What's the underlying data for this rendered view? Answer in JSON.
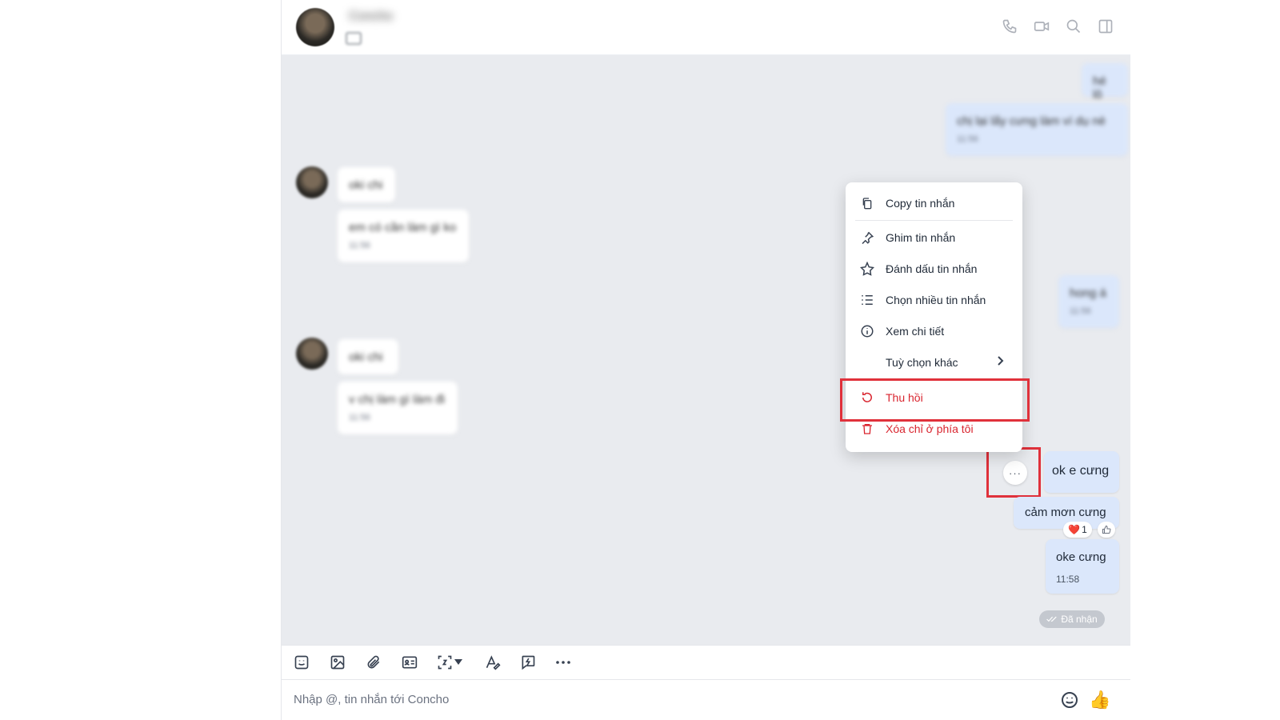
{
  "header": {
    "contact_name": "Concho"
  },
  "blurred": {
    "me_1": "hé lô",
    "me_2": "chị lại lấy cưng làm ví dụ nè",
    "peer_1": "oki chi",
    "peer_2": "em có cần làm gì ko",
    "peer_3": "oki chi",
    "peer_4": "v chị làm gì làm đi",
    "me_3": "hong á",
    "time": "11:56"
  },
  "messages": [
    {
      "text": "ok e cưng"
    },
    {
      "text": "cảm mơn cưng",
      "reaction_emoji": "❤️",
      "reaction_count": "1"
    },
    {
      "text": "oke cưng",
      "time": "11:58"
    }
  ],
  "status": {
    "received": "Đã nhận"
  },
  "context_menu": {
    "copy": "Copy tin nhắn",
    "pin": "Ghim tin nhắn",
    "mark": "Đánh dấu tin nhắn",
    "select_multiple": "Chọn nhiều tin nhắn",
    "details": "Xem chi tiết",
    "more_options": "Tuỳ chọn khác",
    "recall": "Thu hồi",
    "delete_for_me": "Xóa chỉ ở phía tôi"
  },
  "more_button": {
    "label": "···"
  },
  "composer": {
    "placeholder": "Nhập @, tin nhắn tới Concho"
  },
  "colors": {
    "accent_red": "#d9252f",
    "highlight": "#e0313b",
    "bubble_me": "#dbe7fb",
    "chat_bg": "#e9ebef"
  }
}
